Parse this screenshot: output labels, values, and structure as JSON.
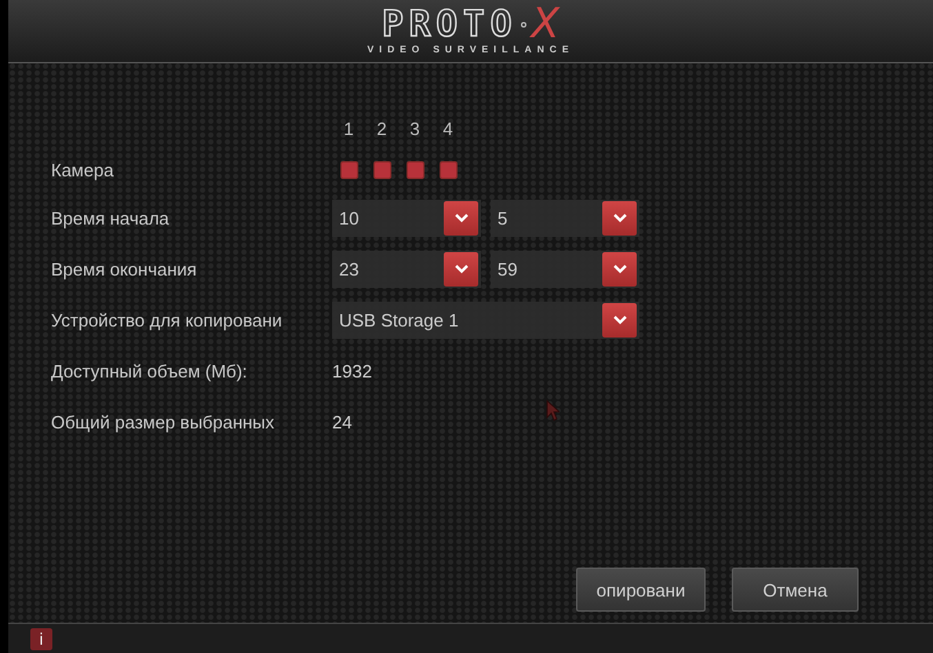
{
  "header": {
    "logo": "PROTO",
    "logo_mark": "X",
    "tagline": "VIDEO SURVEILLANCE"
  },
  "camera": {
    "label": "Камера",
    "channels": [
      {
        "number": "1",
        "checked": true
      },
      {
        "number": "2",
        "checked": true
      },
      {
        "number": "3",
        "checked": true
      },
      {
        "number": "4",
        "checked": true
      }
    ]
  },
  "rows": [
    {
      "kind": "time",
      "label": "Время начала",
      "fields": [
        {
          "value": "10"
        },
        {
          "value": "5"
        }
      ]
    },
    {
      "kind": "time",
      "label": "Время окончания",
      "fields": [
        {
          "value": "23"
        },
        {
          "value": "59"
        }
      ]
    },
    {
      "kind": "select",
      "label": "Устройство для копировани",
      "value": "USB Storage 1"
    },
    {
      "kind": "info",
      "label": "Доступный объем (Мб):",
      "value": "1932"
    },
    {
      "kind": "info",
      "label": "Общий размер выбранных",
      "value": "24"
    }
  ],
  "buttons": [
    {
      "label": "опировани"
    },
    {
      "label": "Отмена"
    }
  ],
  "status_bar": {
    "info_icon": "i"
  }
}
